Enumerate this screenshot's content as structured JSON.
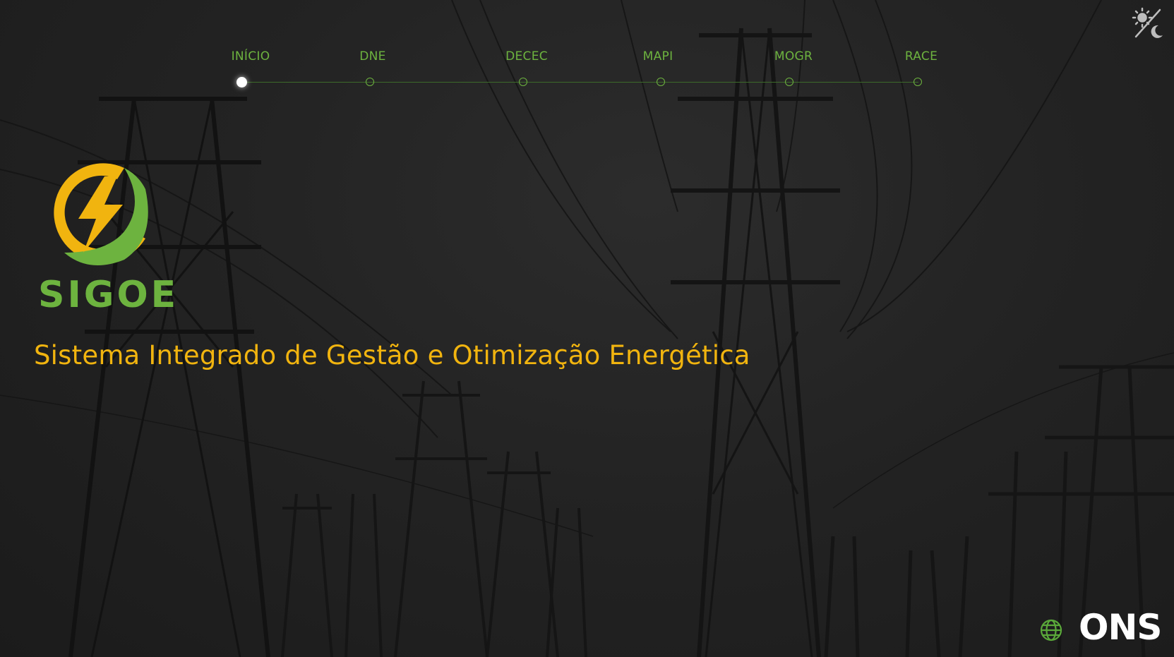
{
  "nav": {
    "items": [
      {
        "label": "INÍCIO",
        "active": true
      },
      {
        "label": "DNE",
        "active": false
      },
      {
        "label": "DECEC",
        "active": false
      },
      {
        "label": "MAPI",
        "active": false
      },
      {
        "label": "MOGR",
        "active": false
      },
      {
        "label": "RACE",
        "active": false
      }
    ]
  },
  "brand": {
    "name": "SIGOE",
    "subtitle": "Sistema Integrado de Gestão e Otimização Energética"
  },
  "footer": {
    "partner_logo": "ONS"
  },
  "icons": {
    "theme_toggle": "sun-moon-icon",
    "language": "globe-icon",
    "logo_mark": "lightning-leaf-icon"
  },
  "colors": {
    "accent_green": "#6db33f",
    "accent_yellow": "#f1b40f",
    "background": "#1e1e1e"
  }
}
